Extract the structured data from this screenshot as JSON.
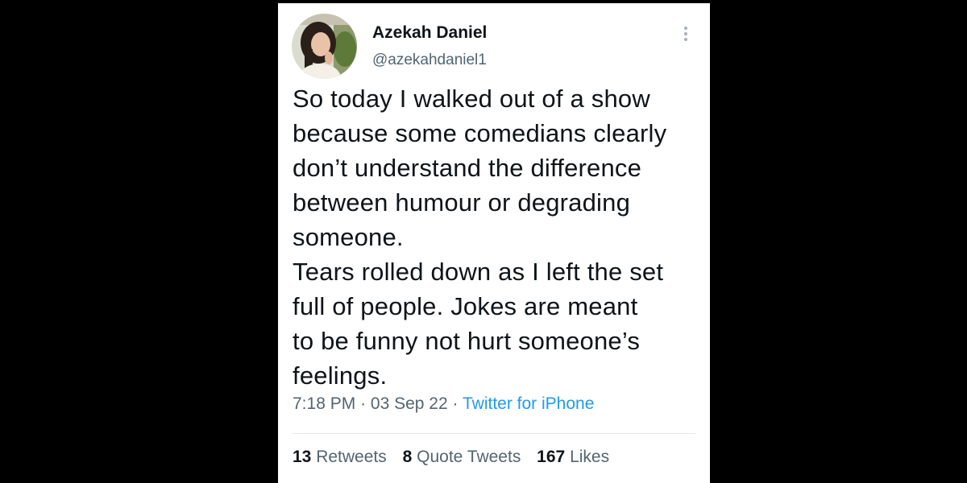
{
  "author": {
    "name": "Azekah Daniel",
    "handle": "@azekahdaniel1"
  },
  "tweet": {
    "lines": [
      "So today I walked out of a show",
      "because some comedians clearly",
      "don’t understand the difference",
      "between humour or degrading",
      "someone.",
      "Tears rolled down as I left the set",
      "full of people. Jokes are meant",
      "to be funny not hurt someone’s",
      "feelings."
    ]
  },
  "meta": {
    "time": "7:18 PM",
    "separator": "·",
    "date": "03 Sep 22",
    "source": "Twitter for iPhone"
  },
  "stats": {
    "retweets": {
      "count": "13",
      "label": "Retweets"
    },
    "quote_tweets": {
      "count": "8",
      "label": "Quote Tweets"
    },
    "likes": {
      "count": "167",
      "label": "Likes"
    }
  },
  "icons": {
    "more": "more-vertical-icon"
  },
  "colors": {
    "text": "#0f1419",
    "secondary": "#536471",
    "link": "#1d9bf0",
    "divider": "#e3e8ec"
  }
}
